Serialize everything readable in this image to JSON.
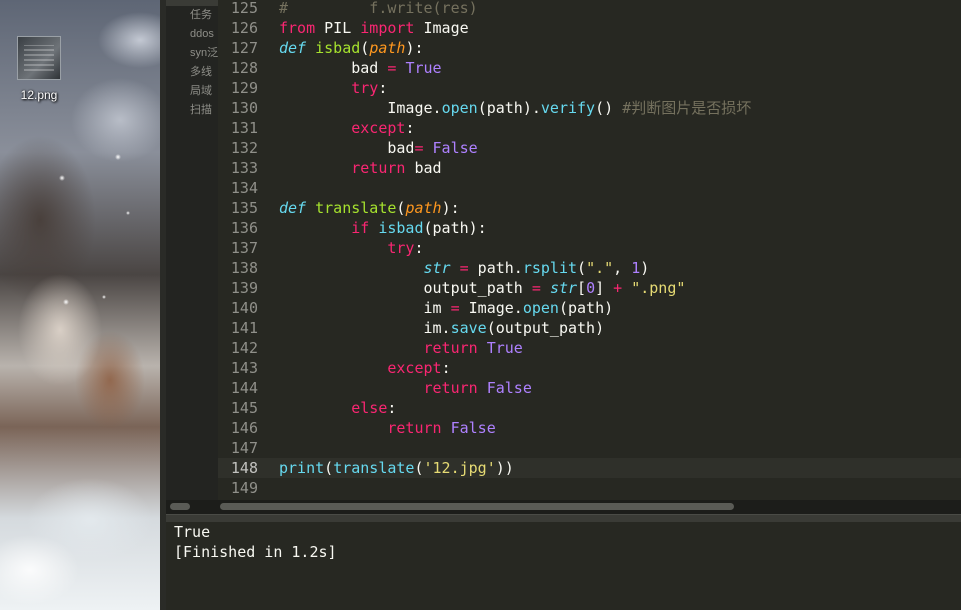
{
  "desktop": {
    "file_icon": {
      "label": "12.png",
      "icon": "image-file-icon"
    }
  },
  "sidebar": {
    "items": [
      {
        "label": "任务"
      },
      {
        "label": "ddos"
      },
      {
        "label": "syn泛"
      },
      {
        "label": "多线"
      },
      {
        "label": "局域"
      },
      {
        "label": "扫描"
      }
    ]
  },
  "editor": {
    "active_line": "148",
    "lines": [
      {
        "num": "125",
        "tokens": [
          {
            "t": "#         f.write(res)",
            "c": "cmt"
          }
        ]
      },
      {
        "num": "126",
        "tokens": [
          {
            "t": "from",
            "c": "kw"
          },
          {
            "t": " PIL ",
            "c": ""
          },
          {
            "t": "import",
            "c": "kw"
          },
          {
            "t": " Image",
            "c": ""
          }
        ]
      },
      {
        "num": "127",
        "tokens": [
          {
            "t": "def",
            "c": "def"
          },
          {
            "t": " ",
            "c": ""
          },
          {
            "t": "isbad",
            "c": "fn"
          },
          {
            "t": "(",
            "c": ""
          },
          {
            "t": "path",
            "c": "param"
          },
          {
            "t": "):",
            "c": ""
          }
        ]
      },
      {
        "num": "128",
        "tokens": [
          {
            "t": "        bad ",
            "c": ""
          },
          {
            "t": "=",
            "c": "kw"
          },
          {
            "t": " ",
            "c": ""
          },
          {
            "t": "True",
            "c": "const"
          }
        ]
      },
      {
        "num": "129",
        "tokens": [
          {
            "t": "        ",
            "c": ""
          },
          {
            "t": "try",
            "c": "kw"
          },
          {
            "t": ":",
            "c": ""
          }
        ]
      },
      {
        "num": "130",
        "tokens": [
          {
            "t": "            Image.",
            "c": ""
          },
          {
            "t": "open",
            "c": "builtin"
          },
          {
            "t": "(path).",
            "c": ""
          },
          {
            "t": "verify",
            "c": "builtin"
          },
          {
            "t": "() ",
            "c": ""
          },
          {
            "t": "#判断图片是否损坏",
            "c": "cmt"
          }
        ]
      },
      {
        "num": "131",
        "tokens": [
          {
            "t": "        ",
            "c": ""
          },
          {
            "t": "except",
            "c": "kw"
          },
          {
            "t": ":",
            "c": ""
          }
        ]
      },
      {
        "num": "132",
        "tokens": [
          {
            "t": "            bad",
            "c": ""
          },
          {
            "t": "=",
            "c": "kw"
          },
          {
            "t": " ",
            "c": ""
          },
          {
            "t": "False",
            "c": "const"
          }
        ]
      },
      {
        "num": "133",
        "tokens": [
          {
            "t": "        ",
            "c": ""
          },
          {
            "t": "return",
            "c": "kw"
          },
          {
            "t": " bad",
            "c": ""
          }
        ]
      },
      {
        "num": "134",
        "tokens": []
      },
      {
        "num": "135",
        "tokens": [
          {
            "t": "def",
            "c": "def"
          },
          {
            "t": " ",
            "c": ""
          },
          {
            "t": "translate",
            "c": "fn"
          },
          {
            "t": "(",
            "c": ""
          },
          {
            "t": "path",
            "c": "param"
          },
          {
            "t": "):",
            "c": ""
          }
        ]
      },
      {
        "num": "136",
        "tokens": [
          {
            "t": "        ",
            "c": ""
          },
          {
            "t": "if",
            "c": "kw"
          },
          {
            "t": " ",
            "c": ""
          },
          {
            "t": "isbad",
            "c": "builtin"
          },
          {
            "t": "(path):",
            "c": ""
          }
        ]
      },
      {
        "num": "137",
        "tokens": [
          {
            "t": "            ",
            "c": ""
          },
          {
            "t": "try",
            "c": "kw"
          },
          {
            "t": ":",
            "c": ""
          }
        ]
      },
      {
        "num": "138",
        "tokens": [
          {
            "t": "                ",
            "c": ""
          },
          {
            "t": "str",
            "c": "def"
          },
          {
            "t": " ",
            "c": ""
          },
          {
            "t": "=",
            "c": "kw"
          },
          {
            "t": " path.",
            "c": ""
          },
          {
            "t": "rsplit",
            "c": "builtin"
          },
          {
            "t": "(",
            "c": ""
          },
          {
            "t": "\".\"",
            "c": "str"
          },
          {
            "t": ", ",
            "c": ""
          },
          {
            "t": "1",
            "c": "const"
          },
          {
            "t": ")",
            "c": ""
          }
        ]
      },
      {
        "num": "139",
        "tokens": [
          {
            "t": "                output_path ",
            "c": ""
          },
          {
            "t": "=",
            "c": "kw"
          },
          {
            "t": " ",
            "c": ""
          },
          {
            "t": "str",
            "c": "def"
          },
          {
            "t": "[",
            "c": ""
          },
          {
            "t": "0",
            "c": "const"
          },
          {
            "t": "] ",
            "c": ""
          },
          {
            "t": "+",
            "c": "kw"
          },
          {
            "t": " ",
            "c": ""
          },
          {
            "t": "\".png\"",
            "c": "str"
          }
        ]
      },
      {
        "num": "140",
        "tokens": [
          {
            "t": "                im ",
            "c": ""
          },
          {
            "t": "=",
            "c": "kw"
          },
          {
            "t": " Image.",
            "c": ""
          },
          {
            "t": "open",
            "c": "builtin"
          },
          {
            "t": "(path)",
            "c": ""
          }
        ]
      },
      {
        "num": "141",
        "tokens": [
          {
            "t": "                im.",
            "c": ""
          },
          {
            "t": "save",
            "c": "builtin"
          },
          {
            "t": "(output_path)",
            "c": ""
          }
        ]
      },
      {
        "num": "142",
        "tokens": [
          {
            "t": "                ",
            "c": ""
          },
          {
            "t": "return",
            "c": "kw"
          },
          {
            "t": " ",
            "c": ""
          },
          {
            "t": "True",
            "c": "const"
          }
        ]
      },
      {
        "num": "143",
        "tokens": [
          {
            "t": "            ",
            "c": ""
          },
          {
            "t": "except",
            "c": "kw"
          },
          {
            "t": ":",
            "c": ""
          }
        ]
      },
      {
        "num": "144",
        "tokens": [
          {
            "t": "                ",
            "c": ""
          },
          {
            "t": "return",
            "c": "kw"
          },
          {
            "t": " ",
            "c": ""
          },
          {
            "t": "False",
            "c": "const"
          }
        ]
      },
      {
        "num": "145",
        "tokens": [
          {
            "t": "        ",
            "c": ""
          },
          {
            "t": "else",
            "c": "kw"
          },
          {
            "t": ":",
            "c": ""
          }
        ]
      },
      {
        "num": "146",
        "tokens": [
          {
            "t": "            ",
            "c": ""
          },
          {
            "t": "return",
            "c": "kw"
          },
          {
            "t": " ",
            "c": ""
          },
          {
            "t": "False",
            "c": "const"
          }
        ]
      },
      {
        "num": "147",
        "tokens": []
      },
      {
        "num": "148",
        "tokens": [
          {
            "t": "print",
            "c": "builtin"
          },
          {
            "t": "(",
            "c": ""
          },
          {
            "t": "translate",
            "c": "builtin"
          },
          {
            "t": "(",
            "c": ""
          },
          {
            "t": "'12.jpg'",
            "c": "str"
          },
          {
            "t": "))",
            "c": ""
          }
        ]
      },
      {
        "num": "149",
        "tokens": []
      }
    ]
  },
  "output": {
    "lines": [
      "True",
      "[Finished in 1.2s]"
    ]
  },
  "colors": {
    "background": "#272822",
    "keyword": "#f92672",
    "function": "#a6e22e",
    "type": "#66d9ef",
    "string": "#e6db74",
    "constant": "#ae81ff",
    "parameter": "#fd971f",
    "comment": "#75715e"
  }
}
